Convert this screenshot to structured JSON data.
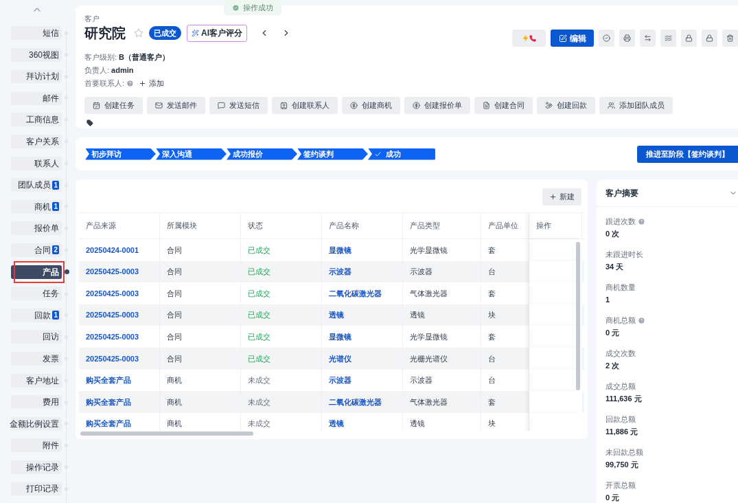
{
  "toast": {
    "text": "操作成功"
  },
  "nav": [
    {
      "label": "短信",
      "selected": false
    },
    {
      "label": "360视图",
      "selected": false
    },
    {
      "label": "拜访计划",
      "selected": false
    },
    {
      "label": "邮件",
      "selected": false
    },
    {
      "label": "工商信息",
      "selected": false
    },
    {
      "label": "客户关系",
      "selected": false
    },
    {
      "label": "联系人",
      "selected": false
    },
    {
      "label": "团队成员",
      "badge": "1",
      "selected": false
    },
    {
      "label": "商机",
      "badge": "1",
      "selected": false
    },
    {
      "label": "报价单",
      "selected": false
    },
    {
      "label": "合同",
      "badge": "2",
      "selected": false
    },
    {
      "label": "产品",
      "selected": true
    },
    {
      "label": "任务",
      "selected": false
    },
    {
      "label": "回款",
      "badge": "1",
      "selected": false
    },
    {
      "label": "回访",
      "selected": false
    },
    {
      "label": "发票",
      "selected": false
    },
    {
      "label": "客户地址",
      "selected": false
    },
    {
      "label": "费用",
      "selected": false
    },
    {
      "label": "金额比例设置",
      "selected": false
    },
    {
      "label": "附件",
      "selected": false
    },
    {
      "label": "操作记录",
      "selected": false
    },
    {
      "label": "打印记录",
      "selected": false
    }
  ],
  "header": {
    "breadcrumb": "客户",
    "title": "研究院",
    "status_badge": "已成交",
    "ai_button": "AI客户评分",
    "edit_button": "编辑",
    "fields": [
      {
        "label": "客户级别:",
        "value": "B（普通客户）"
      },
      {
        "label": "负责人:",
        "value": "admin"
      },
      {
        "label": "首要联系人:",
        "help": true,
        "value": "添加",
        "kind": "add"
      }
    ],
    "actions": [
      "创建任务",
      "发送邮件",
      "发送短信",
      "创建联系人",
      "创建商机",
      "创建报价单",
      "创建合同",
      "创建回款",
      "添加团队成员"
    ]
  },
  "stages": [
    {
      "label": "初步拜访",
      "checked": false
    },
    {
      "label": "深入沟通",
      "checked": false
    },
    {
      "label": "成功报价",
      "checked": false
    },
    {
      "label": "签约谈判",
      "checked": false
    },
    {
      "label": "成功",
      "checked": true
    }
  ],
  "advance_button": "推进至阶段【签约谈判】",
  "table": {
    "new_button": "新建",
    "columns": [
      "产品来源",
      "所属模块",
      "状态",
      "产品名称",
      "产品类型",
      "产品单位",
      "操作"
    ],
    "rows": [
      {
        "source": "20250424-0001",
        "module": "合同",
        "status": "已成交",
        "won": true,
        "name": "显微镜",
        "type": "光学显微镜",
        "unit": "套"
      },
      {
        "source": "20250425-0003",
        "module": "合同",
        "status": "已成交",
        "won": true,
        "name": "示波器",
        "type": "示波器",
        "unit": "台"
      },
      {
        "source": "20250425-0003",
        "module": "合同",
        "status": "已成交",
        "won": true,
        "name": "二氧化碳激光器",
        "type": "气体激光器",
        "unit": "套"
      },
      {
        "source": "20250425-0003",
        "module": "合同",
        "status": "已成交",
        "won": true,
        "name": "透镜",
        "type": "透镜",
        "unit": "块"
      },
      {
        "source": "20250425-0003",
        "module": "合同",
        "status": "已成交",
        "won": true,
        "name": "显微镜",
        "type": "光学显微镜",
        "unit": "套"
      },
      {
        "source": "20250425-0003",
        "module": "合同",
        "status": "已成交",
        "won": true,
        "name": "光谱仪",
        "type": "光栅光谱仪",
        "unit": "台"
      },
      {
        "source": "购买全套产品",
        "module": "商机",
        "status": "未成交",
        "won": false,
        "name": "示波器",
        "type": "示波器",
        "unit": "台"
      },
      {
        "source": "购买全套产品",
        "module": "商机",
        "status": "未成交",
        "won": false,
        "name": "二氧化碳激光器",
        "type": "气体激光器",
        "unit": "套"
      },
      {
        "source": "购买全套产品",
        "module": "商机",
        "status": "未成交",
        "won": false,
        "name": "透镜",
        "type": "透镜",
        "unit": "块"
      }
    ]
  },
  "summary": {
    "title": "客户摘要",
    "items": [
      {
        "label": "跟进次数",
        "help": true,
        "value": "0 次"
      },
      {
        "label": "未跟进时长",
        "help": false,
        "value": "34 天"
      },
      {
        "label": "商机数量",
        "help": false,
        "value": "1"
      },
      {
        "label": "商机总额",
        "help": true,
        "value": "0 元"
      },
      {
        "label": "成交次数",
        "help": false,
        "value": "2 次"
      },
      {
        "label": "成交总额",
        "help": false,
        "value": "111,636 元"
      },
      {
        "label": "回款总额",
        "help": false,
        "value": "11,886 元"
      },
      {
        "label": "未回款总额",
        "help": false,
        "value": "99,750 元"
      },
      {
        "label": "开票总额",
        "help": false,
        "value": "0 元"
      }
    ]
  }
}
